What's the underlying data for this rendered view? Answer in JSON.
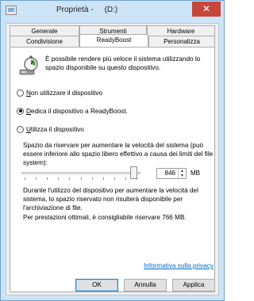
{
  "window": {
    "title": "Proprietà -     (D:)",
    "close_glyph": "✕"
  },
  "tabs": {
    "row1": [
      {
        "label": "Generale",
        "icon": ""
      },
      {
        "label": "Strumenti"
      },
      {
        "label": "Hardware"
      }
    ],
    "row2": [
      {
        "label": "Condivisione"
      },
      {
        "label": "ReadyBoost",
        "active": true
      },
      {
        "label": "Personalizza"
      }
    ]
  },
  "readyboost": {
    "intro": "È possibile rendere più veloce il sistema utilizzando lo spazio disponibile su questo dispositivo.",
    "options": [
      {
        "label_prefix": "",
        "label_underlined": "N",
        "label_rest": "on utilizzare il dispositivo",
        "checked": false
      },
      {
        "label_prefix": "",
        "label_underlined": "D",
        "label_rest": "edica il dispositivo a ReadyBoost.",
        "checked": true
      },
      {
        "label_prefix": "",
        "label_underlined": "U",
        "label_rest": "tilizza il dispositivo",
        "checked": false
      }
    ],
    "space_text": "Spazio da riservare per aumentare la velocità del sistema (può essere inferiore allo spazio libero effettivo a causa dei limiti del file system):",
    "spinner_value": "846",
    "unit": "MB",
    "slider_level": 0.97,
    "note_usage": "Durante l'utilizzo del dispositivo per aumentare la velocità del sistema, lo spazio riservato non risulterà disponibile per l'archiviazione di file.",
    "note_recommend": "Per prestazioni ottimali, è consigliabile riservare 766 MB.",
    "privacy_link": "Informativa sulla privacy"
  },
  "buttons": {
    "ok": "OK",
    "cancel": "Annulla",
    "apply": "Applica"
  },
  "colors": {
    "title_bar": "#cde4f7",
    "close_button": "#c7463b",
    "link": "#0066cc"
  },
  "icons": {
    "title": "drive-properties-icon",
    "readyboost": "readyboost-stopwatch-icon"
  }
}
